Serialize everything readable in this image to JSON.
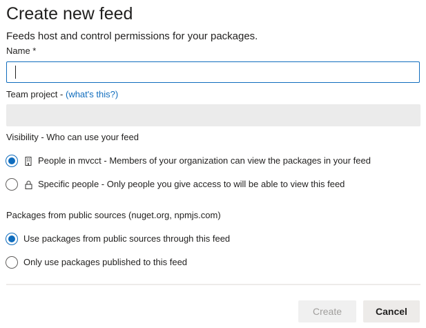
{
  "dialog": {
    "title": "Create new feed",
    "subtitle": "Feeds host and control permissions for your packages."
  },
  "name_field": {
    "label": "Name *",
    "value": ""
  },
  "team_project": {
    "label": "Team project - ",
    "link_text": "(what's this?)",
    "value": ""
  },
  "visibility": {
    "label": "Visibility - Who can use your feed",
    "options": [
      {
        "label": "People in mvcct - Members of your organization can view the packages in your feed",
        "icon": "building-icon",
        "selected": true
      },
      {
        "label": "Specific people - Only people you give access to will be able to view this feed",
        "icon": "lock-icon",
        "selected": false
      }
    ]
  },
  "public_sources": {
    "label": "Packages from public sources (nuget.org, npmjs.com)",
    "options": [
      {
        "label": "Use packages from public sources through this feed",
        "selected": true
      },
      {
        "label": "Only use packages published to this feed",
        "selected": false
      }
    ]
  },
  "buttons": {
    "create": "Create",
    "cancel": "Cancel"
  },
  "colors": {
    "accent": "#0f6cbd",
    "disabled_field": "#ebebeb",
    "button_bg": "#edebe9"
  }
}
